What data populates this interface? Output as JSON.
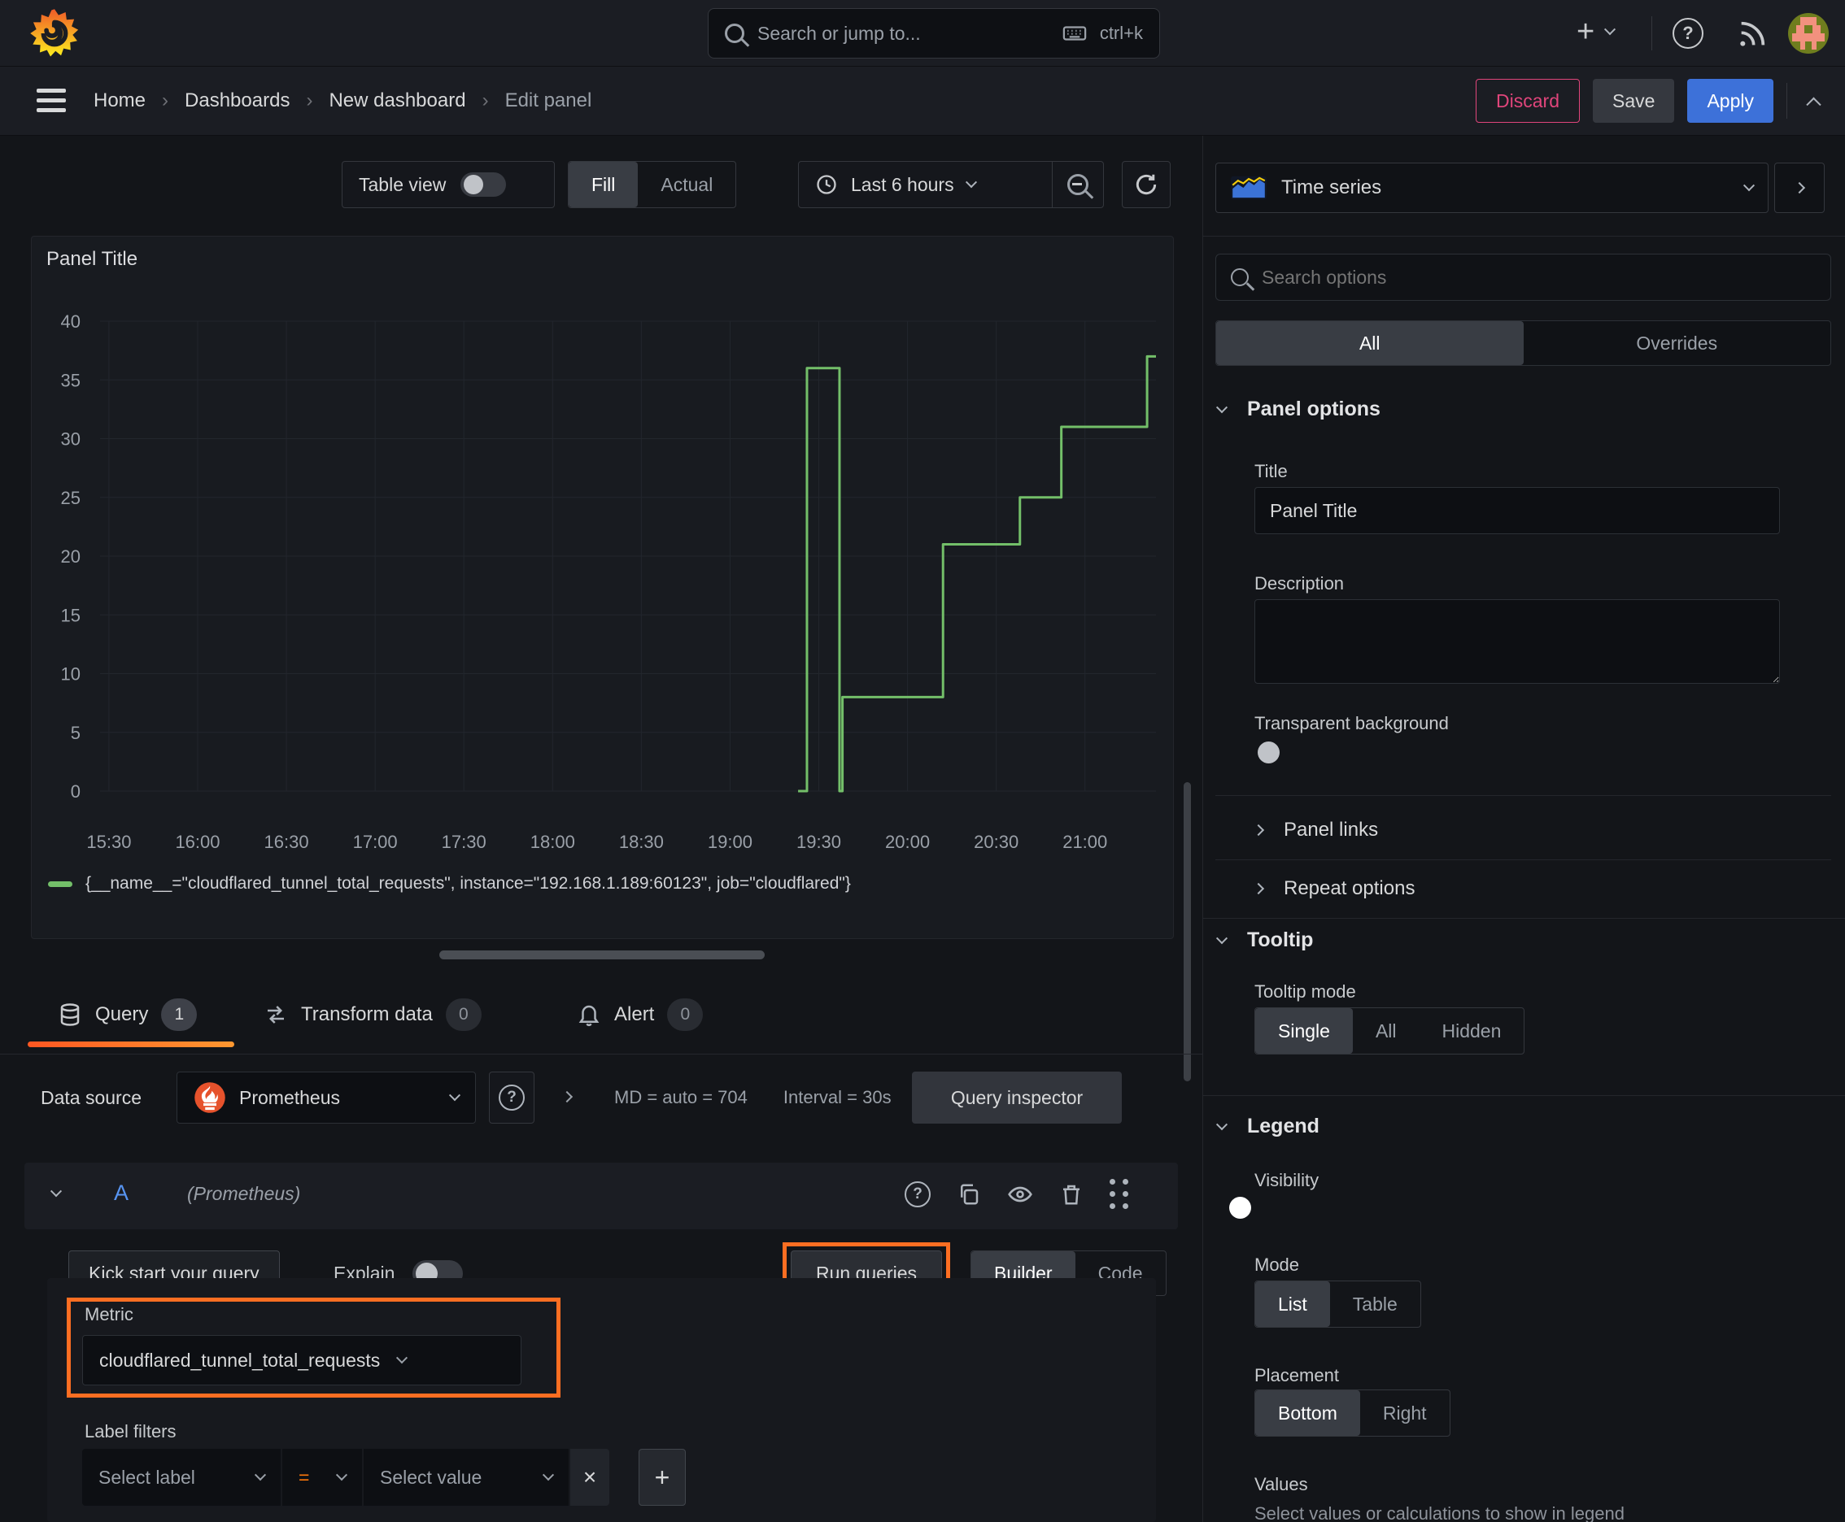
{
  "colors": {
    "accent_orange": "#ff780a",
    "annotation_orange": "#fc6e22",
    "blue": "#3d71d9",
    "pink": "#e0457b",
    "series_green": "#73bf69",
    "tab_underline_from": "#ff5722",
    "tab_underline_to": "#ff9830"
  },
  "icons": {
    "question_glyph": "?",
    "plus_glyph": "+",
    "remove_glyph": "×",
    "breadcrumb_separator": "›"
  },
  "topbar": {
    "search_placeholder": "Search or jump to...",
    "shortcut": "ctrl+k"
  },
  "breadcrumb": {
    "home": "Home",
    "dashboards": "Dashboards",
    "new_dashboard": "New dashboard",
    "edit_panel": "Edit panel",
    "discard": "Discard",
    "save": "Save",
    "apply": "Apply"
  },
  "toolbar": {
    "table_view": "Table view",
    "fill": "Fill",
    "actual": "Actual",
    "time_range": "Last 6 hours"
  },
  "viz_picker": {
    "label": "Time series"
  },
  "options_pane": {
    "search_placeholder": "Search options",
    "tab_all": "All",
    "tab_overrides": "Overrides",
    "panel_options": {
      "header": "Panel options",
      "title_label": "Title",
      "title_value": "Panel Title",
      "description_label": "Description",
      "transparent_label": "Transparent background",
      "panel_links": "Panel links",
      "repeat_options": "Repeat options"
    },
    "tooltip": {
      "header": "Tooltip",
      "mode_label": "Tooltip mode",
      "single": "Single",
      "all": "All",
      "hidden": "Hidden"
    },
    "legend": {
      "header": "Legend",
      "visibility_label": "Visibility",
      "mode_label": "Mode",
      "list": "List",
      "table": "Table",
      "placement_label": "Placement",
      "bottom": "Bottom",
      "right": "Right",
      "values_label": "Values",
      "values_hint": "Select values or calculations to show in legend"
    }
  },
  "panel": {
    "title": "Panel Title"
  },
  "chart_data": {
    "type": "line",
    "line_interpolation": "step-after",
    "title": "Panel Title",
    "xlabel": "",
    "ylabel": "",
    "x_range": [
      "15:27",
      "21:24"
    ],
    "x_ticks": [
      "15:30",
      "16:00",
      "16:30",
      "17:00",
      "17:30",
      "18:00",
      "18:30",
      "19:00",
      "19:30",
      "20:00",
      "20:30",
      "21:00"
    ],
    "ylim": [
      0,
      40
    ],
    "y_ticks": [
      0,
      5,
      10,
      15,
      20,
      25,
      30,
      35,
      40
    ],
    "grid": true,
    "legend_position": "bottom",
    "series": [
      {
        "name": "{__name__=\"cloudflared_tunnel_total_requests\", instance=\"192.168.1.189:60123\", job=\"cloudflared\"}",
        "color": "#73bf69",
        "points": [
          [
            "19:23",
            0
          ],
          [
            "19:26",
            36
          ],
          [
            "19:37",
            0
          ],
          [
            "19:38",
            8
          ],
          [
            "20:12",
            21
          ],
          [
            "20:38",
            25
          ],
          [
            "20:52",
            31
          ],
          [
            "21:21",
            37
          ]
        ]
      }
    ]
  },
  "query_pane": {
    "tabs": {
      "query": "Query",
      "query_count": "1",
      "transform": "Transform data",
      "transform_count": "0",
      "alert": "Alert",
      "alert_count": "0"
    },
    "datasource_label": "Data source",
    "datasource_name": "Prometheus",
    "stats_md": "MD = auto = 704",
    "stats_interval": "Interval = 30s",
    "query_inspector": "Query inspector",
    "ref_id": "A",
    "ref_hint": "(Prometheus)",
    "kick_start": "Kick start your query",
    "explain_label": "Explain",
    "run_queries": "Run queries",
    "builder": "Builder",
    "code": "Code",
    "metric_label": "Metric",
    "metric_value": "cloudflared_tunnel_total_requests",
    "label_filters_label": "Label filters",
    "select_label_placeholder": "Select label",
    "operator": "=",
    "select_value_placeholder": "Select value"
  }
}
